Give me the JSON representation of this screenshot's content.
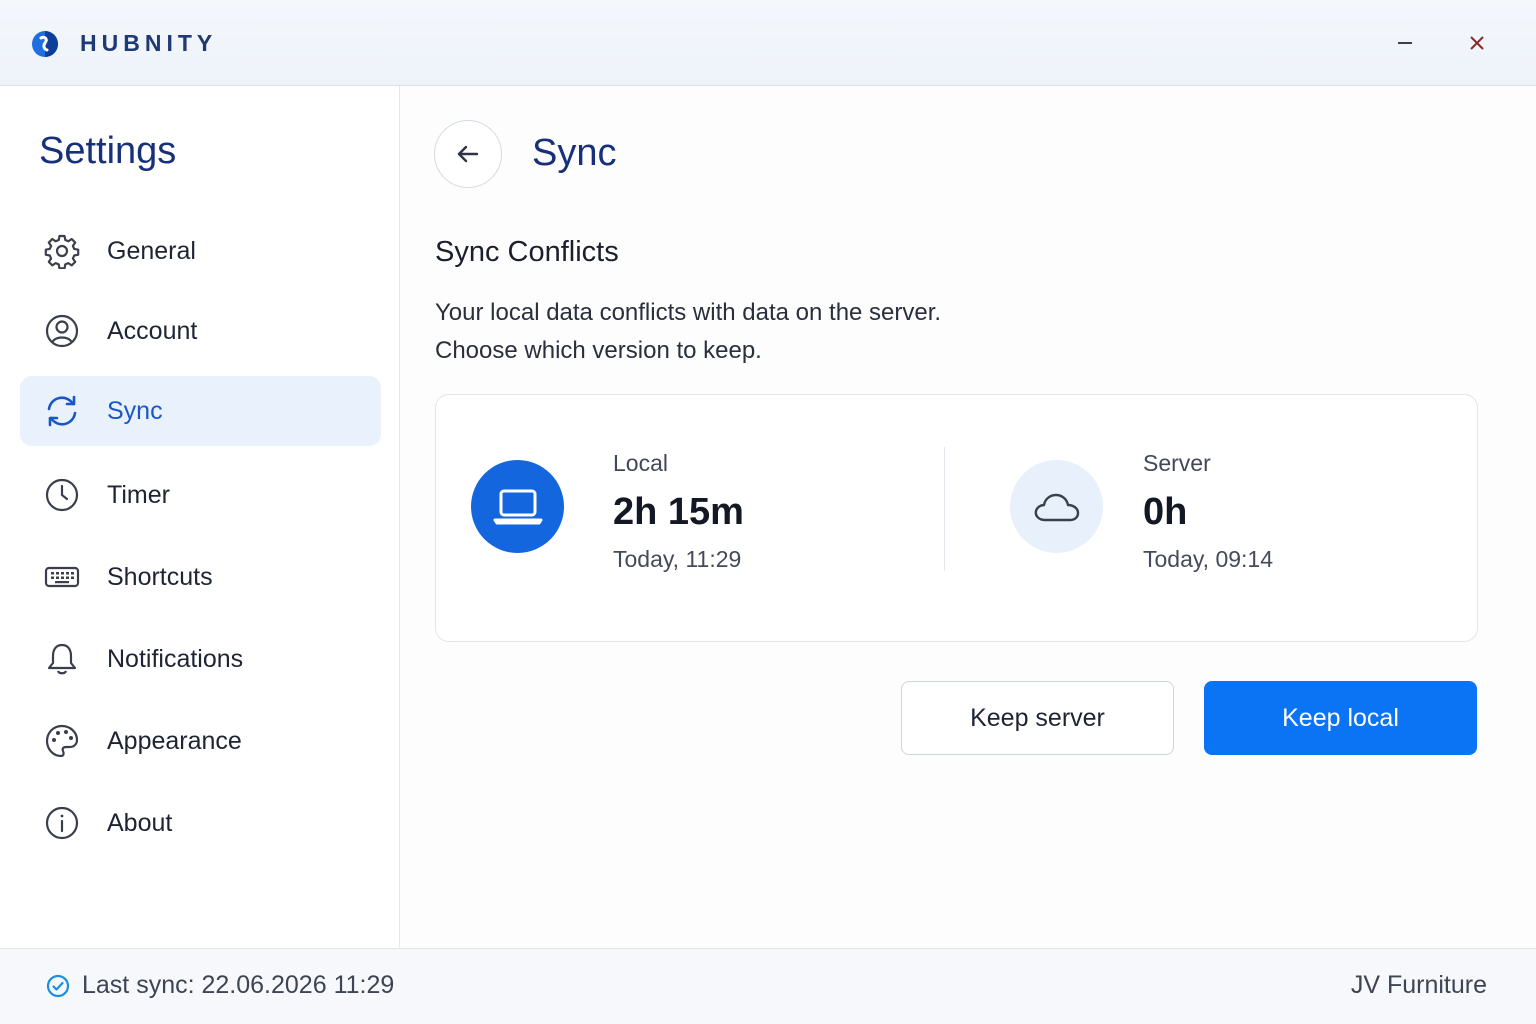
{
  "app": {
    "name": "HUBNITY",
    "logo_icon": "hubnity-logo-icon",
    "minimize_icon": "minimize-icon",
    "close_icon": "close-icon"
  },
  "sidebar": {
    "title": "Settings",
    "items": [
      {
        "label": "General",
        "icon": "gear-icon",
        "active": false
      },
      {
        "label": "Account",
        "icon": "user-circle-icon",
        "active": false
      },
      {
        "label": "Sync",
        "icon": "sync-icon",
        "active": true
      },
      {
        "label": "Timer",
        "icon": "clock-icon",
        "active": false
      },
      {
        "label": "Shortcuts",
        "icon": "keyboard-icon",
        "active": false
      },
      {
        "label": "Notifications",
        "icon": "bell-icon",
        "active": false
      },
      {
        "label": "Appearance",
        "icon": "palette-icon",
        "active": false
      },
      {
        "label": "About",
        "icon": "info-icon",
        "active": false
      }
    ]
  },
  "main": {
    "back_icon": "arrow-left-icon",
    "title": "Sync",
    "section_title": "Sync Conflicts",
    "description_line1": "Your local data conflicts with data on the server.",
    "description_line2": "Choose which version to keep.",
    "local": {
      "label": "Local",
      "value": "2h 15m",
      "time": "Today, 11:29",
      "icon": "laptop-icon"
    },
    "server": {
      "label": "Server",
      "value": "0h",
      "time": "Today, 09:14",
      "icon": "cloud-icon"
    },
    "buttons": {
      "keep_server": "Keep server",
      "keep_local": "Keep local"
    }
  },
  "footer": {
    "last_sync": "Last sync: 22.06.2026 11:29",
    "workspace": "JV Furniture",
    "status_icon": "check-circle-icon"
  },
  "colors": {
    "accent": "#0a74f5",
    "title": "#17307a",
    "active_bg": "#e8f1fc",
    "local_circle": "#1366dd",
    "server_circle": "#e7f0fb"
  }
}
